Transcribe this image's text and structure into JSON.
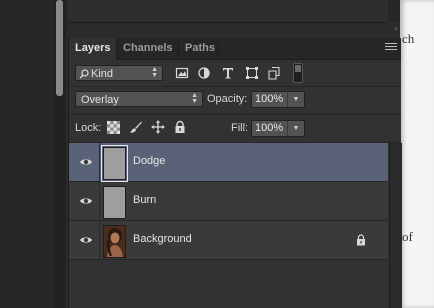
{
  "panel": {
    "tabs": [
      "Layers",
      "Channels",
      "Paths"
    ],
    "active_tab": "Layers"
  },
  "filter": {
    "kind_label": "Kind",
    "icons": [
      "pixel-filter-icon",
      "adjustment-filter-icon",
      "type-filter-icon",
      "shape-filter-icon",
      "smart-object-filter-icon",
      "filter-toggle-switch"
    ]
  },
  "blend": {
    "mode": "Overlay",
    "opacity_label": "Opacity:",
    "opacity_value": "100%"
  },
  "lock": {
    "label": "Lock:",
    "icons": [
      "lock-transparent-pixels-icon",
      "lock-image-pixels-icon",
      "lock-position-icon",
      "lock-all-icon"
    ],
    "fill_label": "Fill:",
    "fill_value": "100%"
  },
  "layers": [
    {
      "name": "Dodge",
      "selected": true,
      "thumbnail": "gray",
      "locked": false
    },
    {
      "name": "Burn",
      "selected": false,
      "thumbnail": "gray",
      "locked": false
    },
    {
      "name": "Background",
      "selected": false,
      "thumbnail": "photo",
      "locked": true
    }
  ],
  "document": {
    "fragments": [
      "ch",
      "of"
    ]
  },
  "colors": {
    "selected_layer": "#5a6278",
    "panel_bg": "#323232",
    "tab_bar": "#262626"
  }
}
